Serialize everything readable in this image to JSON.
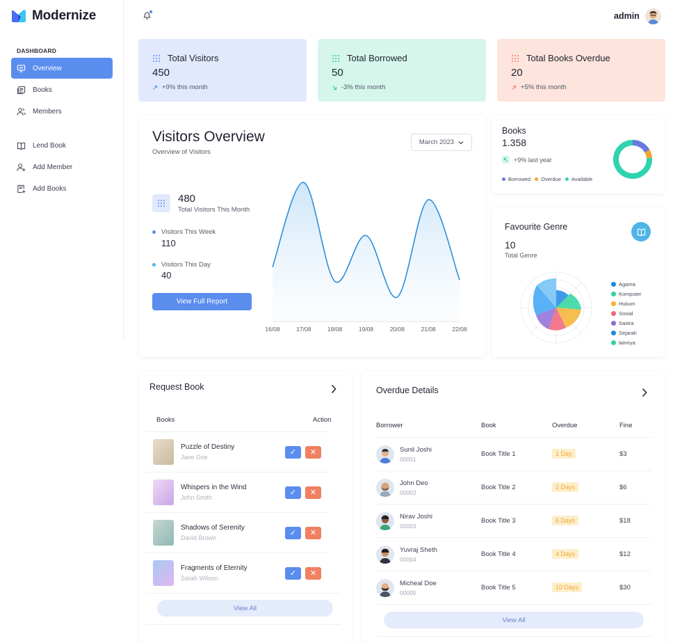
{
  "app": {
    "name": "Modernize"
  },
  "sidebar": {
    "section": "DASHBOARD",
    "items": [
      {
        "label": "Overview",
        "icon": "presentation-icon"
      },
      {
        "label": "Books",
        "icon": "books-icon"
      },
      {
        "label": "Members",
        "icon": "users-icon"
      },
      {
        "label": "Lend Book",
        "icon": "open-book-icon"
      },
      {
        "label": "Add Member",
        "icon": "user-plus-icon"
      },
      {
        "label": "Add Books",
        "icon": "add-books-icon"
      }
    ]
  },
  "topbar": {
    "user": "admin"
  },
  "stats": [
    {
      "title": "Total Visitors",
      "value": "450",
      "trend": "+9% this month",
      "bg": "#e2e9fd",
      "accent": "#5b8def"
    },
    {
      "title": "Total Borrowed",
      "value": "50",
      "trend": "-3% this month",
      "bg": "#d6f6ec",
      "accent": "#2fc89a"
    },
    {
      "title": "Total Books Overdue",
      "value": "20",
      "trend": "+5% this month",
      "bg": "#fde4dc",
      "accent": "#f0805f"
    }
  ],
  "visitors": {
    "title": "Visitors Overview",
    "subtitle": "Overview of Visitors",
    "month": "March 2023",
    "total": "480",
    "total_label": "Total Visitors This Month",
    "week_label": "Visitors This Week",
    "week_value": "110",
    "day_label": "Visitors This Day",
    "day_value": "40",
    "button": "View Full Report"
  },
  "chart_data": {
    "type": "line",
    "x": [
      "16/08",
      "17/08",
      "18/08",
      "19/08",
      "20/08",
      "21/08",
      "22/08"
    ],
    "values": [
      0.38,
      0.97,
      0.28,
      0.6,
      0.17,
      0.85,
      0.29
    ],
    "color": "#2b8fd6"
  },
  "books_card": {
    "title": "Books",
    "value": "1.358",
    "trend": "+9% last year",
    "legend": [
      {
        "label": "Borrowed",
        "color": "#6d78e0"
      },
      {
        "label": "Overdue",
        "color": "#f5a530"
      },
      {
        "label": "Available",
        "color": "#2fd3b0"
      }
    ]
  },
  "genre": {
    "title": "Favourite Genre",
    "value": "10",
    "label": "Total Genre",
    "legend": [
      {
        "label": "Agama",
        "color": "#1e88e5"
      },
      {
        "label": "Komputer",
        "color": "#2ed39e"
      },
      {
        "label": "Hukum",
        "color": "#f5b230"
      },
      {
        "label": "Sosial",
        "color": "#f2607a"
      },
      {
        "label": "Sastra",
        "color": "#8e6cd6"
      },
      {
        "label": "Sejarah",
        "color": "#1e88e5"
      },
      {
        "label": "lainnya",
        "color": "#2ed39e"
      }
    ]
  },
  "request": {
    "title": "Request Book",
    "col_books": "Books",
    "col_action": "Action",
    "rows": [
      {
        "title": "Puzzle of Destiny",
        "author": "Jane Doe"
      },
      {
        "title": "Whispers in the Wind",
        "author": "John Smith"
      },
      {
        "title": "Shadows of Serenity",
        "author": "David Brown"
      },
      {
        "title": "Fragments of Eternity",
        "author": "Sarah Wilson"
      }
    ],
    "view_all": "View All"
  },
  "overdue": {
    "title": "Overdue Details",
    "cols": [
      "Borrower",
      "Book",
      "Overdue",
      "Fine"
    ],
    "rows": [
      {
        "name": "Sunil Joshi",
        "id": "00001",
        "book": "Book Title 1",
        "overdue": "1 Day",
        "fine": "$3"
      },
      {
        "name": "John Deo",
        "id": "00002",
        "book": "Book Title 2",
        "overdue": "2 Days",
        "fine": "$6"
      },
      {
        "name": "Nirav Joshi",
        "id": "00003",
        "book": "Book Title 3",
        "overdue": "6 Days",
        "fine": "$18"
      },
      {
        "name": "Yuvraj Sheth",
        "id": "00004",
        "book": "Book Title 4",
        "overdue": "4 Days",
        "fine": "$12"
      },
      {
        "name": "Micheal Doe",
        "id": "00005",
        "book": "Book Title 5",
        "overdue": "10 Days",
        "fine": "$30"
      }
    ],
    "view_all": "View All"
  }
}
